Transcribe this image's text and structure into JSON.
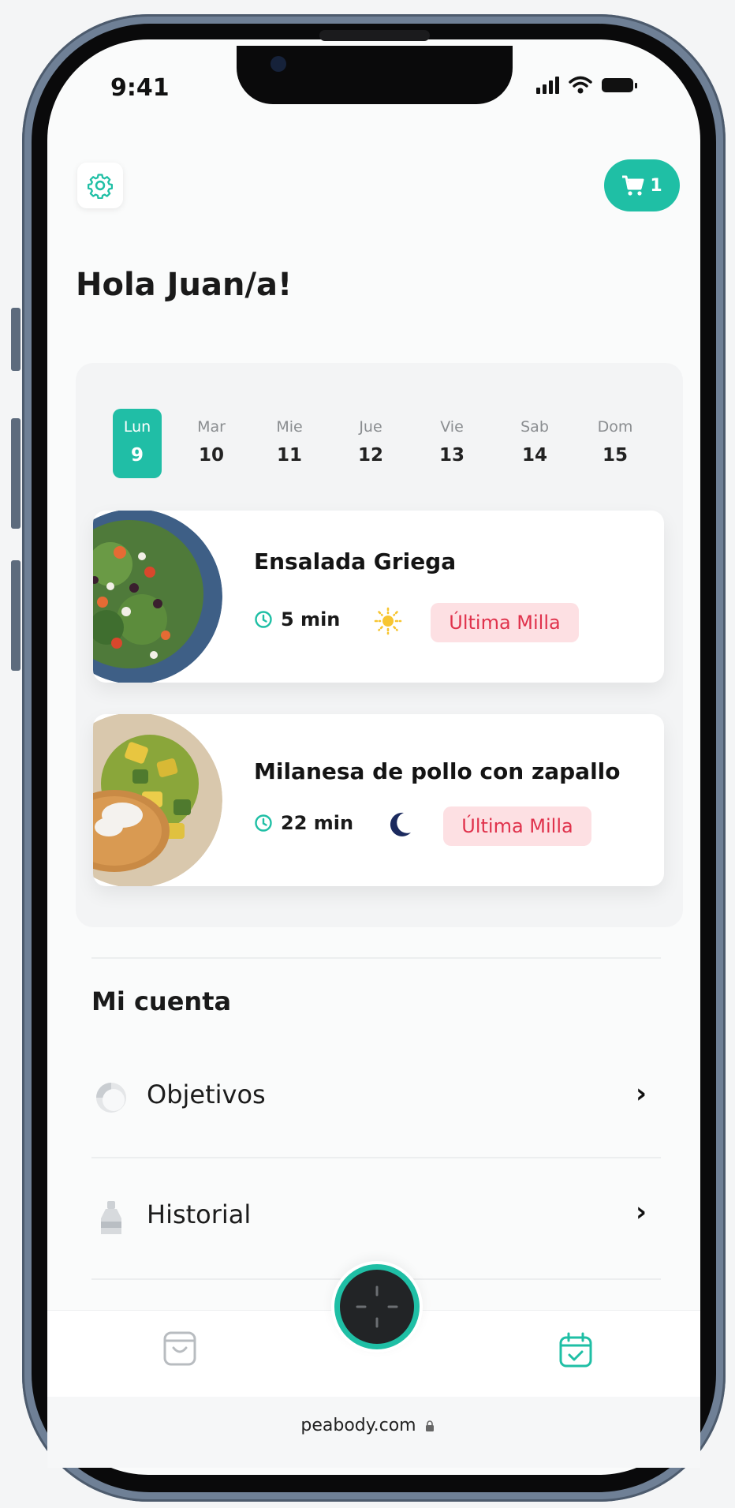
{
  "status_bar": {
    "time": "9:41"
  },
  "header": {
    "cart_count": "1"
  },
  "greeting": "Hola Juan/a!",
  "week": {
    "days": [
      {
        "name": "Lun",
        "date": "9",
        "active": true
      },
      {
        "name": "Mar",
        "date": "10"
      },
      {
        "name": "Mie",
        "date": "11"
      },
      {
        "name": "Jue",
        "date": "12"
      },
      {
        "name": "Vie",
        "date": "13"
      },
      {
        "name": "Sab",
        "date": "14"
      },
      {
        "name": "Dom",
        "date": "15"
      }
    ]
  },
  "meals": [
    {
      "title": "Ensalada Griega",
      "time": "5 min",
      "period_icon": "sun-icon",
      "tag": "Última Milla"
    },
    {
      "title": "Milanesa de pollo con zapallo",
      "time": "22 min",
      "period_icon": "moon-icon",
      "tag": "Última Milla"
    }
  ],
  "account": {
    "title": "Mi cuenta",
    "items": [
      {
        "label": "Objetivos",
        "icon": "pie-chart-icon"
      },
      {
        "label": "Historial",
        "icon": "bottle-icon"
      }
    ]
  },
  "browser": {
    "url": "peabody.com"
  },
  "colors": {
    "accent": "#1fbfa5",
    "tag_bg": "#fde0e3",
    "tag_text": "#e0324c",
    "sun": "#f7c531",
    "moon": "#1b2a5e"
  }
}
